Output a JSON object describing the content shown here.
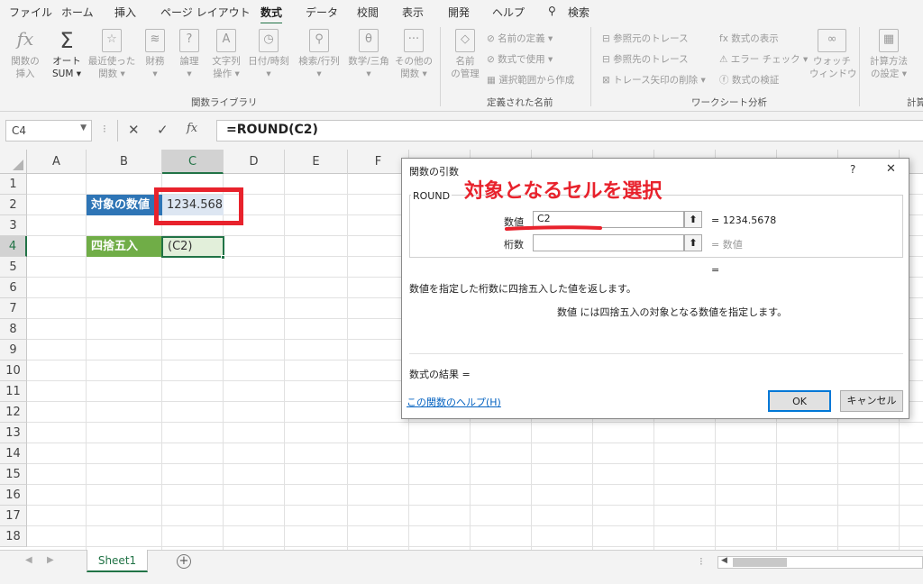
{
  "menu": {
    "tabs": [
      "ファイル",
      "ホーム",
      "挿入",
      "ページ レイアウト",
      "数式",
      "データ",
      "校閲",
      "表示",
      "開発",
      "ヘルプ",
      "検索"
    ],
    "active_tab": "数式"
  },
  "ribbon": {
    "insert_function": [
      "関数の",
      "挿入"
    ],
    "autosum": [
      "オート",
      "SUM"
    ],
    "recent": [
      "最近使った",
      "関数"
    ],
    "financial": "財務",
    "logical": "論理",
    "text": [
      "文字列",
      "操作"
    ],
    "datetime": "日付/時刻",
    "lookup": "検索/行列",
    "math": "数学/三角",
    "other": [
      "その他の",
      "関数"
    ],
    "group_library": "関数ライブラリ",
    "name_manager": [
      "名前",
      "の管理"
    ],
    "define_name": "名前の定義",
    "use_in_formula": "数式で使用",
    "create_from_selection": "選択範囲から作成",
    "group_names": "定義された名前",
    "trace_precedents": "参照元のトレース",
    "trace_dependents": "参照先のトレース",
    "remove_arrows": "トレース矢印の削除",
    "show_formulas": "数式の表示",
    "error_check": "エラー チェック",
    "evaluate_formula": "数式の検証",
    "watch_window": [
      "ウォッチ",
      "ウィンドウ"
    ],
    "group_audit": "ワークシート分析",
    "calc_options": [
      "計算方法",
      "の設定"
    ],
    "group_calc": "計算"
  },
  "formula_bar": {
    "name_box": "C4",
    "formula": "=ROUND(C2)",
    "fx": "fx"
  },
  "grid": {
    "columns": [
      "A",
      "B",
      "C",
      "D",
      "E",
      "F"
    ],
    "rows": [
      "1",
      "2",
      "3",
      "4",
      "5",
      "6",
      "7",
      "8",
      "9",
      "10",
      "11",
      "12",
      "13",
      "14",
      "15",
      "16",
      "17",
      "18"
    ],
    "b2": "対象の数値",
    "c2": "1234.568",
    "b4": "四捨五入",
    "c4": "(C2)"
  },
  "sheet_tab": "Sheet1",
  "dialog": {
    "title": "関数の引数",
    "help_symbol": "?",
    "close_symbol": "✕",
    "function_name": "ROUND",
    "arg1_label": "数値",
    "arg1_value": "C2",
    "arg1_result": "= 1234.5678",
    "arg2_label": "桁数",
    "arg2_value": "",
    "arg2_result": "= 数値",
    "overall_result": "=",
    "description": "数値を指定した桁数に四捨五入した値を返します。",
    "arg_description": "数値  には四捨五入の対象となる数値を指定します。",
    "formula_result": "数式の結果 =",
    "help_link": "この関数のヘルプ(H)",
    "ok": "OK",
    "cancel": "キャンセル"
  },
  "annotation": {
    "text": "対象となるセルを選択",
    "color": "#e8222c"
  },
  "colors": {
    "label_blue": "#2e75b6",
    "label_green": "#70ad47",
    "excel_green": "#217346",
    "highlight_red": "#e8222c"
  }
}
